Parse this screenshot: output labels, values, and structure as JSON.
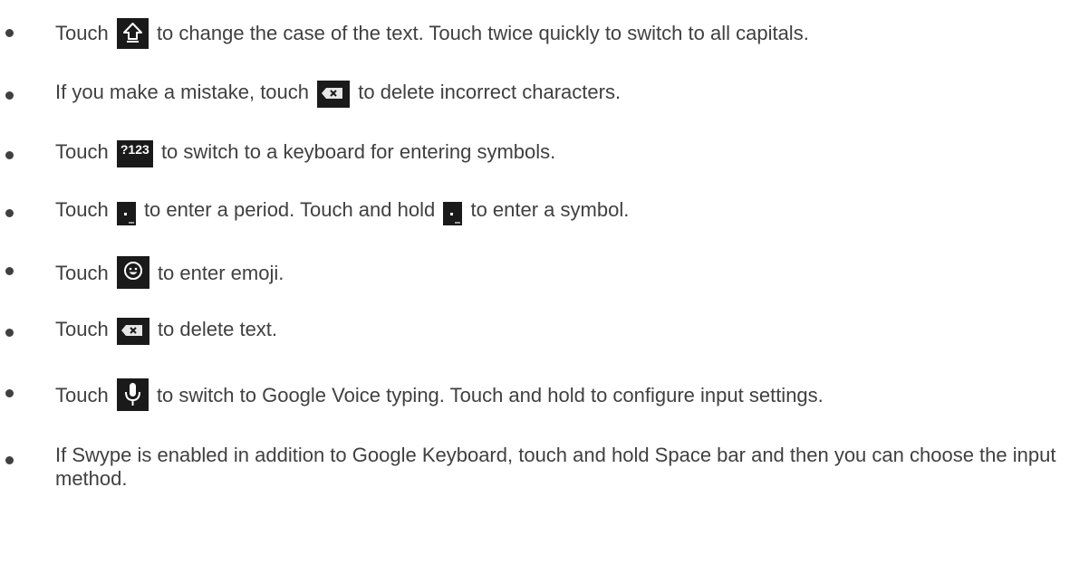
{
  "items": [
    {
      "before": "Touch",
      "icon": "shift-icon",
      "after": "to change the case of the text. Touch twice quickly to switch to all capitals."
    },
    {
      "before": "If you make a mistake, touch",
      "icon": "delete-icon",
      "after": "to delete incorrect characters."
    },
    {
      "before": "Touch",
      "icon": "symbols-key-icon",
      "icon_label": "?123",
      "after": "to switch to a keyboard for entering symbols."
    },
    {
      "before": "Touch",
      "icon": "period-key-icon",
      "middle": "to enter a period. Touch and hold",
      "icon2": "period-key-icon",
      "after": "to enter a symbol."
    },
    {
      "before": "Touch",
      "icon": "emoji-icon",
      "after": "to enter emoji."
    },
    {
      "before": "Touch",
      "icon": "delete-icon",
      "after": "to delete text."
    },
    {
      "before": "Touch",
      "icon": "microphone-icon",
      "after": "to switch to Google Voice typing. Touch and hold to configure input settings."
    },
    {
      "text": "If Swype is enabled in addition to Google Keyboard, touch and hold Space bar and then you can choose the input method."
    }
  ]
}
